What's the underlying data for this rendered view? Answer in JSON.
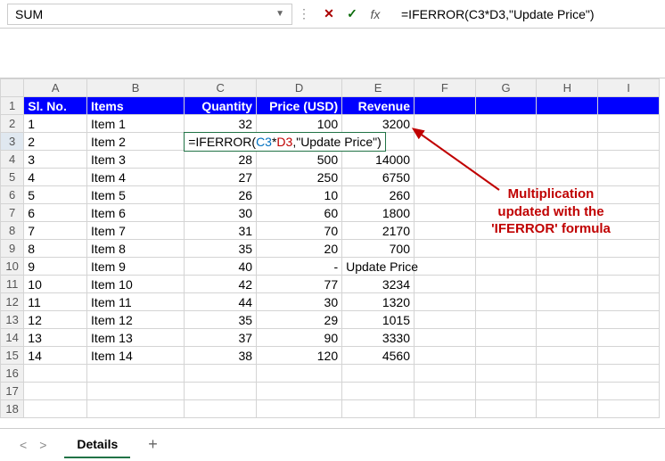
{
  "nameBox": "SUM",
  "formulaBar": "=IFERROR(C3*D3,\"Update Price\")",
  "columns": [
    "A",
    "B",
    "C",
    "D",
    "E",
    "F",
    "G",
    "H",
    "I"
  ],
  "headerRow": {
    "a": "Sl. No.",
    "b": "Items",
    "c": "Quantity",
    "d": "Price (USD)",
    "e": "Revenue"
  },
  "rows": [
    {
      "n": 1,
      "a": "1",
      "b": "Item 1",
      "c": "32",
      "d": "100",
      "e": "3200"
    },
    {
      "n": 2,
      "a": "2",
      "b": "Item 2",
      "c_formula": "=IFERROR(C3*D3,\"Update Price\")",
      "editing": true
    },
    {
      "n": 3,
      "a": "3",
      "b": "Item 3",
      "c": "28",
      "d": "500",
      "e": "14000"
    },
    {
      "n": 4,
      "a": "4",
      "b": "Item 4",
      "c": "27",
      "d": "250",
      "e": "6750"
    },
    {
      "n": 5,
      "a": "5",
      "b": "Item 5",
      "c": "26",
      "d": "10",
      "e": "260"
    },
    {
      "n": 6,
      "a": "6",
      "b": "Item 6",
      "c": "30",
      "d": "60",
      "e": "1800"
    },
    {
      "n": 7,
      "a": "7",
      "b": "Item 7",
      "c": "31",
      "d": "70",
      "e": "2170"
    },
    {
      "n": 8,
      "a": "8",
      "b": "Item 8",
      "c": "35",
      "d": "20",
      "e": "700"
    },
    {
      "n": 9,
      "a": "9",
      "b": "Item 9",
      "c": "40",
      "d": "-",
      "e": "Update Price"
    },
    {
      "n": 10,
      "a": "10",
      "b": "Item 10",
      "c": "42",
      "d": "77",
      "e": "3234"
    },
    {
      "n": 11,
      "a": "11",
      "b": "Item 11",
      "c": "44",
      "d": "30",
      "e": "1320"
    },
    {
      "n": 12,
      "a": "12",
      "b": "Item 12",
      "c": "35",
      "d": "29",
      "e": "1015"
    },
    {
      "n": 13,
      "a": "13",
      "b": "Item 13",
      "c": "37",
      "d": "90",
      "e": "3330"
    },
    {
      "n": 14,
      "a": "14",
      "b": "Item 14",
      "c": "38",
      "d": "120",
      "e": "4560"
    }
  ],
  "emptyRows": [
    16,
    17,
    18
  ],
  "callout": {
    "l1": "Multiplication",
    "l2": "updated with the",
    "l3": "'IFERROR' formula"
  },
  "sheetTab": "Details",
  "formula_parts": {
    "pre": "=IFERROR(",
    "c3": "C3",
    "star": "*",
    "d3": "D3",
    "post": ",\"Update Price\")"
  }
}
